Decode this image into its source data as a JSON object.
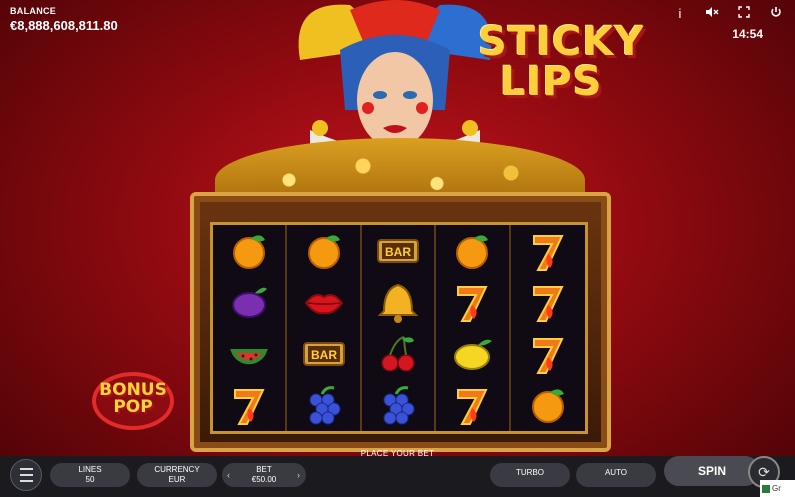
{
  "balance": {
    "label": "BALANCE",
    "value": "€8,888,608,811.80"
  },
  "header": {
    "time": "14:54",
    "icons": [
      "info-icon",
      "sound-off-icon",
      "fullscreen-icon",
      "power-icon"
    ]
  },
  "title": {
    "line1": "STICKY",
    "line2": "LIPS"
  },
  "bonus_logo": {
    "line1": "BONUS",
    "line2": "POP"
  },
  "reels": [
    [
      "orange",
      "plum",
      "watermelon",
      "seven"
    ],
    [
      "orange",
      "lips",
      "bar",
      "grapes"
    ],
    [
      "bar",
      "bell",
      "cherry",
      "grapes"
    ],
    [
      "orange",
      "seven",
      "lemon",
      "seven"
    ],
    [
      "seven",
      "seven",
      "seven",
      "orange"
    ]
  ],
  "bar_symbol_text": "BAR",
  "controls": {
    "place_bet": "PLACE YOUR BET",
    "lines_label": "LINES",
    "lines_value": "50",
    "currency_label": "CURRENCY",
    "currency_value": "EUR",
    "bet_label": "BET",
    "bet_value": "€50.00",
    "bet_decrease": "‹",
    "bet_increase": "›",
    "turbo": "TURBO",
    "auto": "AUTO",
    "spin": "SPIN"
  },
  "taskbar_peek": "Gr",
  "colors": {
    "background": "#b5121a",
    "gold": "#ffcf3a",
    "bar": "#1a1a1f"
  }
}
